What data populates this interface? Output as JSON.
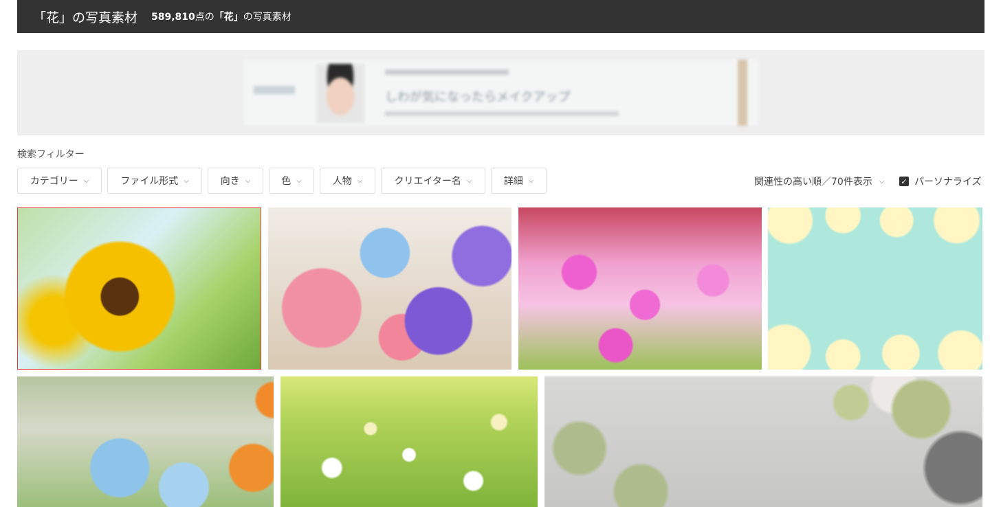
{
  "header": {
    "title": "「花」の写真素材",
    "count": "589,810",
    "count_suffix": "点の",
    "keyword": "「花」",
    "count_tail": "の写真素材"
  },
  "ad": {
    "headline": "しわが気になったらメイクアップ"
  },
  "filter_label": "検索フィルター",
  "filters": [
    {
      "label": "カテゴリー"
    },
    {
      "label": "ファイル形式"
    },
    {
      "label": "向き"
    },
    {
      "label": "色"
    },
    {
      "label": "人物"
    },
    {
      "label": "クリエイター名"
    },
    {
      "label": "詳細"
    }
  ],
  "sort": {
    "label": "関連性の高い順／70件表示"
  },
  "personalize": {
    "label": "パーソナライズ",
    "checked": true
  },
  "photos": [
    {
      "subject": "sunflower"
    },
    {
      "subject": "morning-glory"
    },
    {
      "subject": "cosmos"
    },
    {
      "subject": "plumeria"
    },
    {
      "subject": "delphinium-tulip"
    },
    {
      "subject": "chamomile"
    },
    {
      "subject": "dried-botanicals"
    }
  ],
  "icons": {
    "chevron": "chevron-down-icon",
    "check": "check-icon"
  }
}
